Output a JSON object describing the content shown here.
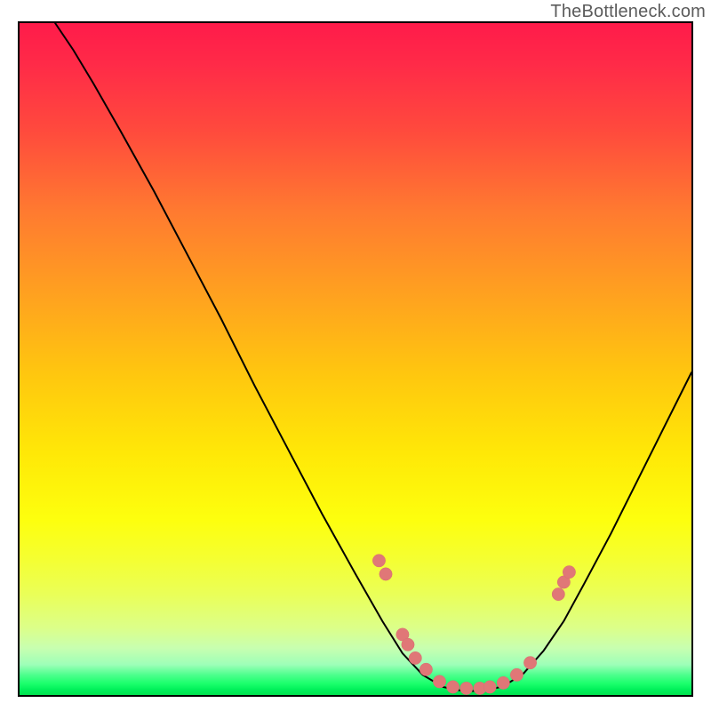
{
  "watermark": "TheBottleneck.com",
  "colors": {
    "curve": "#000000",
    "marker_fill": "#e07777",
    "marker_stroke": "#d86f6f",
    "gradient_top": "#ff1b4a",
    "gradient_bottom": "#00e24e",
    "frame_border": "#000000"
  },
  "chart_data": {
    "type": "line",
    "title": "",
    "xlabel": "",
    "ylabel": "",
    "xlim": [
      0,
      100
    ],
    "ylim": [
      0,
      100
    ],
    "grid": false,
    "legend": false,
    "annotations": [],
    "curve_points": [
      {
        "x": 5.3,
        "y": 100.0
      },
      {
        "x": 8.0,
        "y": 96.0
      },
      {
        "x": 11.0,
        "y": 91.0
      },
      {
        "x": 15.0,
        "y": 84.0
      },
      {
        "x": 20.0,
        "y": 75.0
      },
      {
        "x": 25.0,
        "y": 65.5
      },
      {
        "x": 30.0,
        "y": 56.0
      },
      {
        "x": 35.0,
        "y": 46.0
      },
      {
        "x": 40.0,
        "y": 36.5
      },
      {
        "x": 45.0,
        "y": 27.0
      },
      {
        "x": 50.0,
        "y": 18.0
      },
      {
        "x": 54.0,
        "y": 11.0
      },
      {
        "x": 57.0,
        "y": 6.2
      },
      {
        "x": 60.0,
        "y": 3.0
      },
      {
        "x": 63.0,
        "y": 1.2
      },
      {
        "x": 66.0,
        "y": 0.6
      },
      {
        "x": 69.0,
        "y": 0.6
      },
      {
        "x": 72.0,
        "y": 1.3
      },
      {
        "x": 75.0,
        "y": 3.2
      },
      {
        "x": 78.0,
        "y": 6.6
      },
      {
        "x": 81.0,
        "y": 11.0
      },
      {
        "x": 84.0,
        "y": 16.5
      },
      {
        "x": 88.0,
        "y": 24.0
      },
      {
        "x": 92.0,
        "y": 32.0
      },
      {
        "x": 96.0,
        "y": 40.0
      },
      {
        "x": 100.0,
        "y": 48.0
      }
    ],
    "markers": [
      {
        "x": 53.5,
        "y": 20.0
      },
      {
        "x": 54.5,
        "y": 18.0
      },
      {
        "x": 57.0,
        "y": 9.0
      },
      {
        "x": 57.8,
        "y": 7.5
      },
      {
        "x": 58.9,
        "y": 5.5
      },
      {
        "x": 60.5,
        "y": 3.8
      },
      {
        "x": 62.5,
        "y": 2.0
      },
      {
        "x": 64.5,
        "y": 1.2
      },
      {
        "x": 66.5,
        "y": 1.0
      },
      {
        "x": 68.5,
        "y": 1.0
      },
      {
        "x": 70.0,
        "y": 1.2
      },
      {
        "x": 72.0,
        "y": 1.8
      },
      {
        "x": 74.0,
        "y": 3.0
      },
      {
        "x": 76.0,
        "y": 4.8
      },
      {
        "x": 80.2,
        "y": 15.0
      },
      {
        "x": 81.0,
        "y": 16.8
      },
      {
        "x": 81.8,
        "y": 18.3
      }
    ],
    "marker_radius_pct": 0.95
  }
}
